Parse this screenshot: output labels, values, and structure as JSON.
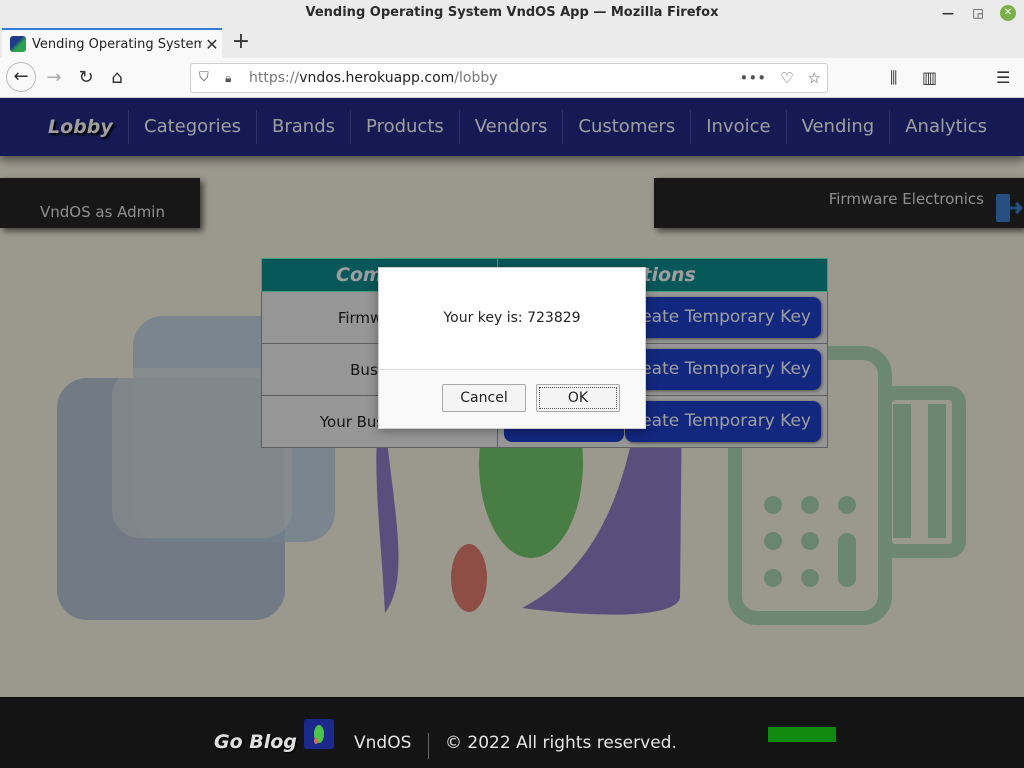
{
  "window": {
    "title": "Vending Operating System VndOS App — Mozilla Firefox"
  },
  "tab": {
    "title": "Vending Operating System"
  },
  "address_bar": {
    "scheme": "https://",
    "host": "vndos.herokuapp.com",
    "path": "/lobby"
  },
  "site_nav": {
    "lobby": "Lobby",
    "items": [
      "Categories",
      "Brands",
      "Products",
      "Vendors",
      "Customers",
      "Invoice",
      "Vending",
      "Analytics"
    ]
  },
  "user": {
    "label": "VndOS as Admin"
  },
  "company": {
    "name": "Firmware Electronics"
  },
  "company_table": {
    "headers": [
      "Compan",
      "ptions"
    ],
    "rows": [
      {
        "name": "Firmware E",
        "action": "reate Temporary Key"
      },
      {
        "name": "Busines",
        "action": "reate Temporary Key"
      },
      {
        "name": "Your Business N",
        "action": "reate Temporary Key"
      }
    ]
  },
  "footer": {
    "go_blog": "Go Blog",
    "brand": "VndOS",
    "copyright": "© 2022 All rights reserved."
  },
  "dialog": {
    "message": "Your key is: 723829",
    "cancel": "Cancel",
    "ok": "OK"
  },
  "colors": {
    "nav_bg": "#232b8a",
    "table_header": "#0d8f91",
    "button_blue": "#1e3fcc",
    "page_bg": "#fbf6e4"
  }
}
